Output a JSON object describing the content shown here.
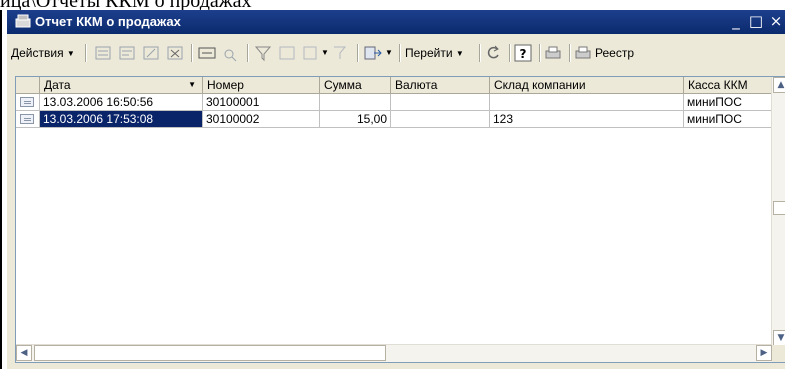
{
  "caption": "ица\\Отчеты ККМ о продажах",
  "window": {
    "title": "Отчет ККМ о продажах"
  },
  "toolbar": {
    "actions_label": "Действия",
    "goto_label": "Перейти",
    "registry_label": "Реестр"
  },
  "table": {
    "columns": [
      "Дата",
      "Номер",
      "Сумма",
      "Валюта",
      "Склад компании",
      "Касса ККМ"
    ],
    "rows": [
      {
        "date": "13.03.2006 16:50:56",
        "number": "30100001",
        "sum": "",
        "currency": "",
        "warehouse": "",
        "kassa": "миниПОС"
      },
      {
        "date": "13.03.2006 17:53:08",
        "number": "30100002",
        "sum": "15,00",
        "currency": "",
        "warehouse": "123",
        "kassa": "миниПОС"
      }
    ],
    "selected_row": 1,
    "sort_indicator": "▼"
  },
  "icons": [
    "app-icon",
    "minimize-icon",
    "maximize-icon",
    "close-icon",
    "row-doc-icon",
    "help-icon",
    "refresh-icon",
    "print-icon"
  ]
}
